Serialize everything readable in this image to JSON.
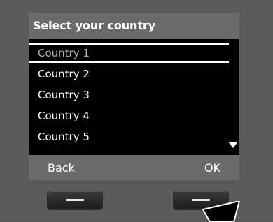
{
  "screen": {
    "title": "Select your country",
    "items": [
      {
        "label": "Country 1",
        "selected": true
      },
      {
        "label": "Country 2",
        "selected": false
      },
      {
        "label": "Country 3",
        "selected": false
      },
      {
        "label": "Country 4",
        "selected": false
      },
      {
        "label": "Country 5",
        "selected": false
      }
    ],
    "scroll_icon": "triangle-down-icon"
  },
  "softkeys": {
    "left_label": "Back",
    "right_label": "OK"
  },
  "hardware": {
    "left_key_icon": "dash-icon",
    "right_key_icon": "dash-icon",
    "pointer_icon": "arrow-pointer-icon"
  },
  "colors": {
    "header_bg": "#6a6a6a",
    "screen_bg": "#000000",
    "selected_text": "#b4b4b4",
    "text": "#ffffff"
  }
}
